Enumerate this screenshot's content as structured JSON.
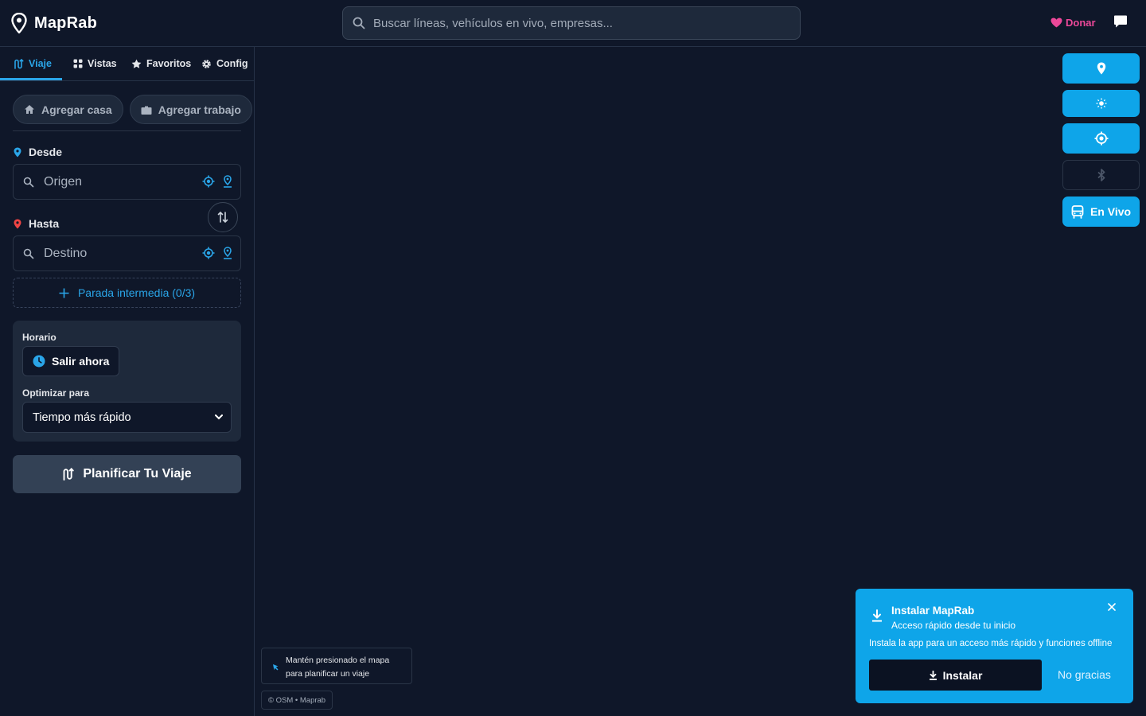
{
  "header": {
    "logo_text": "MapRab",
    "search_placeholder": "Buscar líneas, vehículos en vivo, empresas...",
    "donate_label": "Donar"
  },
  "sidebar": {
    "tabs": [
      {
        "label": "Viaje",
        "icon": "route-icon",
        "active": true
      },
      {
        "label": "Vistas",
        "icon": "grid-icon",
        "active": false
      },
      {
        "label": "Favoritos",
        "icon": "star-icon",
        "active": false
      },
      {
        "label": "Config",
        "icon": "gear-icon",
        "active": false
      }
    ],
    "quick": {
      "home_label": "Agregar casa",
      "work_label": "Agregar trabajo"
    },
    "from": {
      "label": "Desde",
      "placeholder": "Origen"
    },
    "to": {
      "label": "Hasta",
      "placeholder": "Destino"
    },
    "waypoint_label": "Parada intermedia (0/3)",
    "schedule": {
      "label": "Horario",
      "depart_label": "Salir ahora"
    },
    "optimize": {
      "label": "Optimizar para",
      "selected": "Tiempo más rápido"
    },
    "plan_label": "Planificar Tu Viaje"
  },
  "map": {
    "live_label": "En Vivo",
    "hint_line1": "Mantén presionado el mapa",
    "hint_line2": "para planificar un viaje",
    "attribution": "© OSM • Maprab"
  },
  "install_toast": {
    "title": "Instalar MapRab",
    "subtitle": "Acceso rápido desde tu inicio",
    "description": "Instala la app para un acceso más rápido y funciones offline",
    "install_label": "Instalar",
    "dismiss_label": "No gracias"
  },
  "colors": {
    "background": "#0f1729",
    "accent": "#0ea5e9",
    "donate": "#ec4899",
    "destination_pin": "#ef4444"
  }
}
